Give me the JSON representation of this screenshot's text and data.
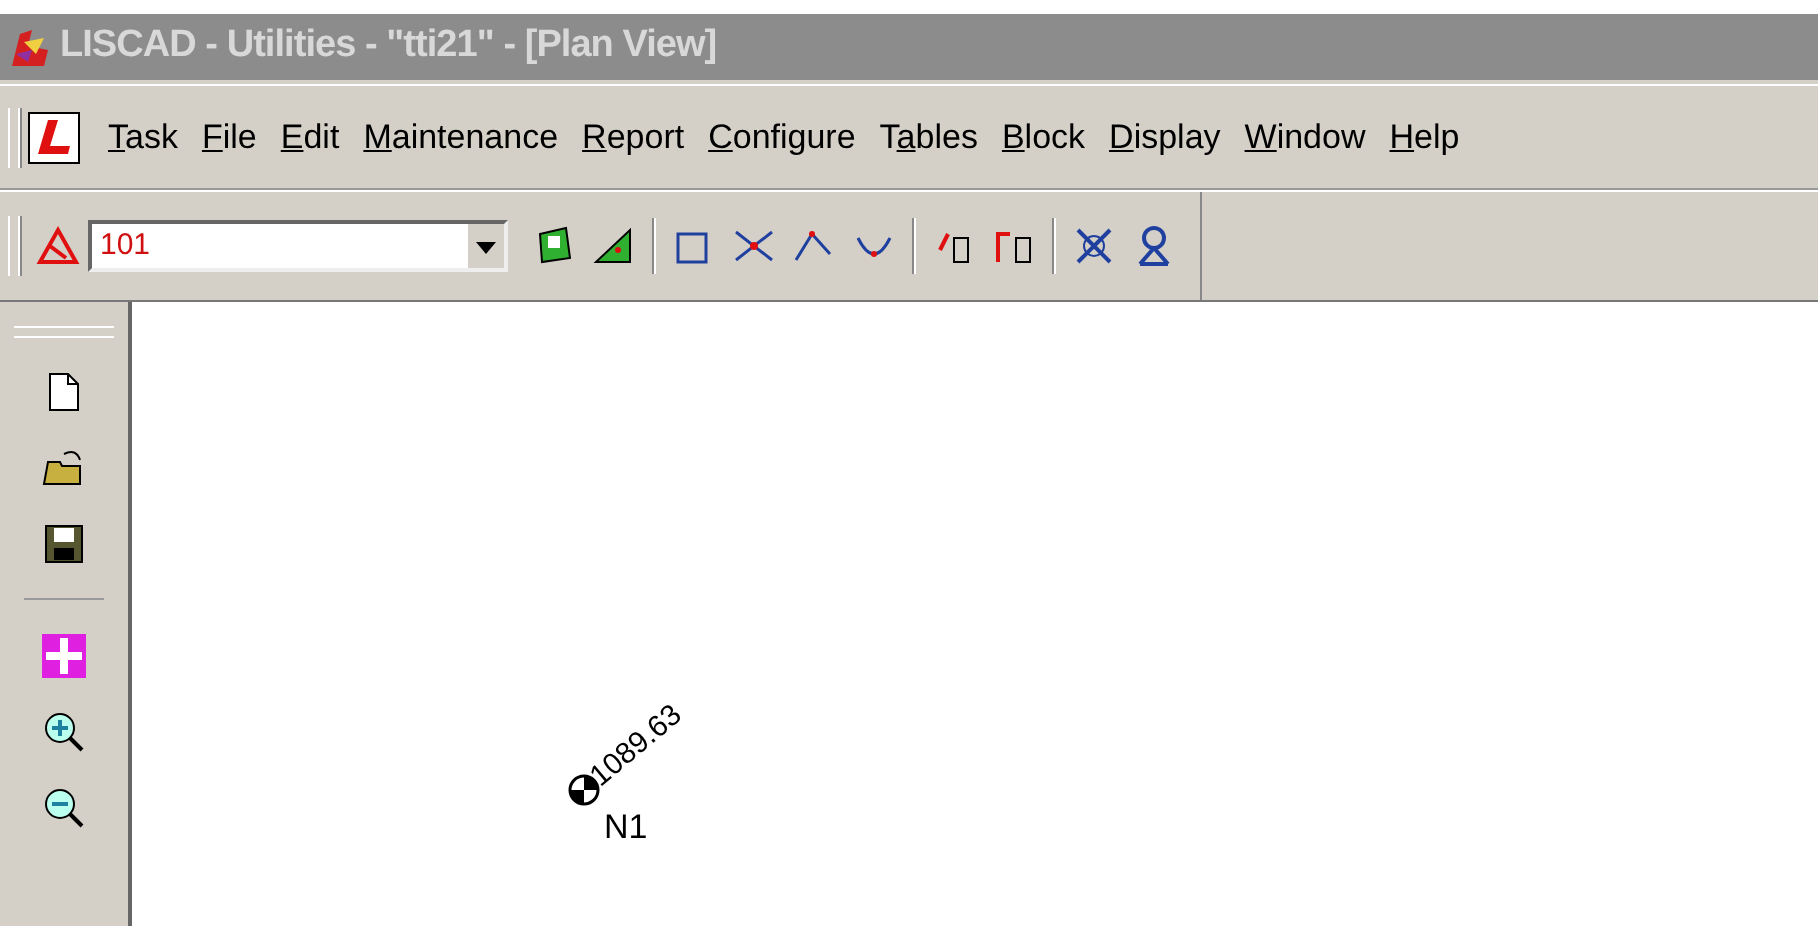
{
  "window": {
    "title": "LISCAD - Utilities - \"tti21\" - [Plan View]"
  },
  "menu": [
    {
      "key": "T",
      "post": "ask"
    },
    {
      "key": "F",
      "post": "ile"
    },
    {
      "key": "E",
      "post": "dit"
    },
    {
      "key": "M",
      "post": "aintenance"
    },
    {
      "key": "R",
      "post": "eport"
    },
    {
      "key": "C",
      "post": "onfigure"
    },
    {
      "pre": "T",
      "key": "a",
      "post": "bles"
    },
    {
      "key": "B",
      "post": "lock"
    },
    {
      "key": "D",
      "post": "isplay"
    },
    {
      "key": "W",
      "post": "indow"
    },
    {
      "key": "H",
      "post": "elp"
    }
  ],
  "toolbar": {
    "point_combo": {
      "value": "101"
    }
  },
  "canvas": {
    "points": [
      {
        "name": "N1",
        "elevation": "1089.63"
      }
    ]
  }
}
